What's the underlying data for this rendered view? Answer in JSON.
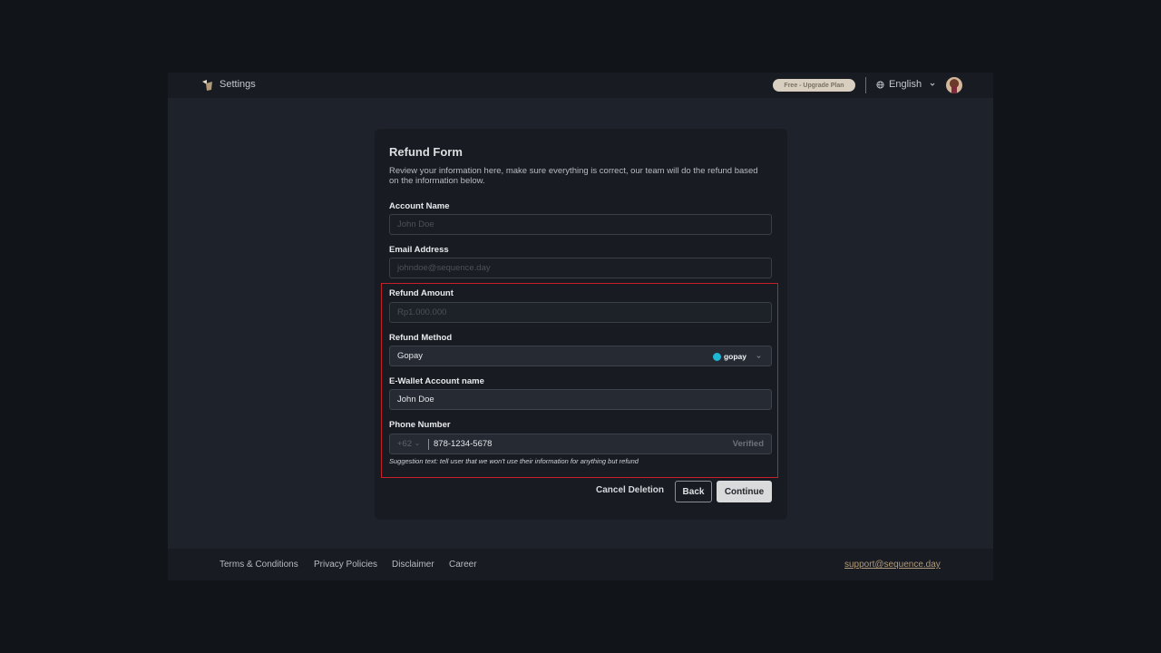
{
  "header": {
    "title": "Settings",
    "upgrade_badge": "Free - Upgrade Plan",
    "language": "English",
    "icons": {
      "logo": "sequence-logo",
      "globe": "globe-icon",
      "chevron": "chevron-down-icon",
      "avatar": "user-avatar"
    }
  },
  "form": {
    "title": "Refund Form",
    "description": "Review your information here, make sure everything is correct, our team will do the refund based on the information below.",
    "fields": {
      "account_name": {
        "label": "Account Name",
        "placeholder": "John Doe",
        "value": ""
      },
      "email": {
        "label": "Email Address",
        "placeholder": "johndoe@sequence.day",
        "value": ""
      },
      "refund_amount": {
        "label": "Refund Amount",
        "placeholder": "Rp1.000.000",
        "value": ""
      },
      "refund_method": {
        "label": "Refund Method",
        "value": "Gopay",
        "brand_logo_text": "gopay",
        "brand_color": "#1eb8d6"
      },
      "ewallet_name": {
        "label": "E-Wallet Account name",
        "value": "John Doe"
      },
      "phone": {
        "label": "Phone Number",
        "country_code": "+62",
        "value": "878-1234-5678",
        "status": "Verified"
      }
    },
    "suggestion": "Suggestion text: tell user that we won't use their information for anything but refund",
    "highlight_color": "#c8202a",
    "buttons": {
      "cancel": "Cancel Deletion",
      "back": "Back",
      "continue": "Continue"
    }
  },
  "footer": {
    "links": [
      "Terms & Conditions",
      "Privacy Policies",
      "Disclaimer",
      "Career"
    ],
    "support_email": "support@sequence.day"
  }
}
